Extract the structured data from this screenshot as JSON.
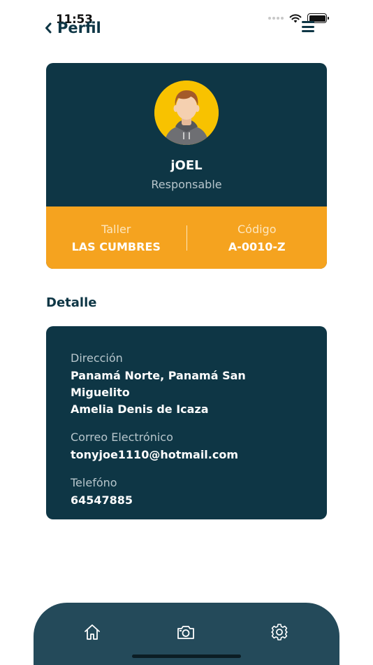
{
  "status_bar": {
    "time": "11:53"
  },
  "header": {
    "title": "Perfil"
  },
  "profile": {
    "name": "jOEL",
    "role": "Responsable",
    "stats": [
      {
        "label": "Taller",
        "value": "LAS CUMBRES"
      },
      {
        "label": "Código",
        "value": "A-0010-Z"
      }
    ]
  },
  "detail": {
    "title": "Detalle",
    "address_label": "Dirección",
    "address_line1": "Panamá Norte, Panamá San Miguelito",
    "address_line2": "Amelia Denis de Icaza",
    "email_label": "Correo Electrónico",
    "email": "tonyjoe1110@hotmail.com",
    "phone_label": "Telefóno",
    "phone": "64547885"
  },
  "tabbar": {
    "icons": [
      "home-icon",
      "camera-icon",
      "gear-icon"
    ]
  },
  "colors": {
    "primary": "#0e3645",
    "accent": "#f5a31f",
    "tabbar": "#244a5a"
  }
}
